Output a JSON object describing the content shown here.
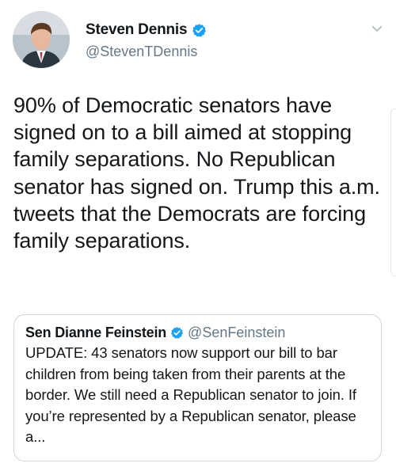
{
  "author": {
    "display_name": "Steven Dennis",
    "handle": "@StevenTDennis",
    "verified": true,
    "avatar_icon": "profile-photo"
  },
  "tweet": {
    "text": "90% of Democratic senators have signed on to a bill aimed at stopping family separations. No Republican senator has signed on. Trump this a.m. tweets that the Democrats are forcing family separations."
  },
  "quoted_tweet": {
    "display_name": "Sen Dianne Feinstein",
    "handle": "@SenFeinstein",
    "verified": true,
    "text": "UPDATE: 43 senators now support our bill to bar children from being taken from their parents at the border. We still need a Republican senator to join. If you’re represented by a Republican senator, please a..."
  },
  "colors": {
    "verified_blue": "#1da1f2",
    "secondary_text": "#657786",
    "border": "#ccd6dd"
  },
  "icons": {
    "menu": "chevron-down-icon",
    "verified": "verified-badge-icon"
  }
}
